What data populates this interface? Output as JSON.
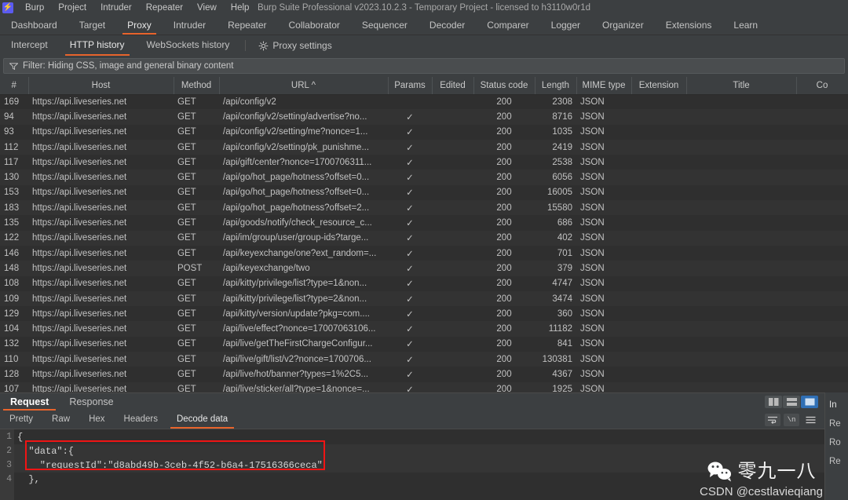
{
  "window": {
    "title": "Burp Suite Professional v2023.10.2.3 - Temporary Project - licensed to h3110w0r1d",
    "logo_icon": "burp-lightning-icon"
  },
  "menubar": {
    "items": [
      "Burp",
      "Project",
      "Intruder",
      "Repeater",
      "View",
      "Help"
    ]
  },
  "main_tabs": {
    "active": "Proxy",
    "items": [
      "Dashboard",
      "Target",
      "Proxy",
      "Intruder",
      "Repeater",
      "Collaborator",
      "Sequencer",
      "Decoder",
      "Comparer",
      "Logger",
      "Organizer",
      "Extensions",
      "Learn"
    ]
  },
  "sub_tabs": {
    "active": "HTTP history",
    "items": [
      "Intercept",
      "HTTP history",
      "WebSockets history"
    ],
    "settings_label": "Proxy settings",
    "settings_icon": "gear-icon"
  },
  "filter": {
    "icon": "funnel-icon",
    "text": "Filter: Hiding CSS, image and general binary content"
  },
  "table": {
    "columns": [
      "#",
      "Host",
      "Method",
      "URL ^",
      "Params",
      "Edited",
      "Status code",
      "Length",
      "MIME type",
      "Extension",
      "Title",
      "Co"
    ],
    "check_glyph": "✓",
    "rows": [
      {
        "num": "169",
        "host": "https://api.liveseries.net",
        "method": "GET",
        "url": "/api/config/v2",
        "params": "",
        "edited": "",
        "status": "200",
        "length": "2308",
        "mime": "JSON",
        "extension": "",
        "title": ""
      },
      {
        "num": "94",
        "host": "https://api.liveseries.net",
        "method": "GET",
        "url": "/api/config/v2/setting/advertise?no...",
        "params": "✓",
        "edited": "",
        "status": "200",
        "length": "8716",
        "mime": "JSON",
        "extension": "",
        "title": ""
      },
      {
        "num": "93",
        "host": "https://api.liveseries.net",
        "method": "GET",
        "url": "/api/config/v2/setting/me?nonce=1...",
        "params": "✓",
        "edited": "",
        "status": "200",
        "length": "1035",
        "mime": "JSON",
        "extension": "",
        "title": ""
      },
      {
        "num": "112",
        "host": "https://api.liveseries.net",
        "method": "GET",
        "url": "/api/config/v2/setting/pk_punishme...",
        "params": "✓",
        "edited": "",
        "status": "200",
        "length": "2419",
        "mime": "JSON",
        "extension": "",
        "title": ""
      },
      {
        "num": "117",
        "host": "https://api.liveseries.net",
        "method": "GET",
        "url": "/api/gift/center?nonce=1700706311...",
        "params": "✓",
        "edited": "",
        "status": "200",
        "length": "2538",
        "mime": "JSON",
        "extension": "",
        "title": ""
      },
      {
        "num": "130",
        "host": "https://api.liveseries.net",
        "method": "GET",
        "url": "/api/go/hot_page/hotness?offset=0...",
        "params": "✓",
        "edited": "",
        "status": "200",
        "length": "6056",
        "mime": "JSON",
        "extension": "",
        "title": ""
      },
      {
        "num": "153",
        "host": "https://api.liveseries.net",
        "method": "GET",
        "url": "/api/go/hot_page/hotness?offset=0...",
        "params": "✓",
        "edited": "",
        "status": "200",
        "length": "16005",
        "mime": "JSON",
        "extension": "",
        "title": ""
      },
      {
        "num": "183",
        "host": "https://api.liveseries.net",
        "method": "GET",
        "url": "/api/go/hot_page/hotness?offset=2...",
        "params": "✓",
        "edited": "",
        "status": "200",
        "length": "15580",
        "mime": "JSON",
        "extension": "",
        "title": ""
      },
      {
        "num": "135",
        "host": "https://api.liveseries.net",
        "method": "GET",
        "url": "/api/goods/notify/check_resource_c...",
        "params": "✓",
        "edited": "",
        "status": "200",
        "length": "686",
        "mime": "JSON",
        "extension": "",
        "title": ""
      },
      {
        "num": "122",
        "host": "https://api.liveseries.net",
        "method": "GET",
        "url": "/api/im/group/user/group-ids?targe...",
        "params": "✓",
        "edited": "",
        "status": "200",
        "length": "402",
        "mime": "JSON",
        "extension": "",
        "title": ""
      },
      {
        "num": "146",
        "host": "https://api.liveseries.net",
        "method": "GET",
        "url": "/api/keyexchange/one?ext_random=...",
        "params": "✓",
        "edited": "",
        "status": "200",
        "length": "701",
        "mime": "JSON",
        "extension": "",
        "title": ""
      },
      {
        "num": "148",
        "host": "https://api.liveseries.net",
        "method": "POST",
        "url": "/api/keyexchange/two",
        "params": "✓",
        "edited": "",
        "status": "200",
        "length": "379",
        "mime": "JSON",
        "extension": "",
        "title": ""
      },
      {
        "num": "108",
        "host": "https://api.liveseries.net",
        "method": "GET",
        "url": "/api/kitty/privilege/list?type=1&non...",
        "params": "✓",
        "edited": "",
        "status": "200",
        "length": "4747",
        "mime": "JSON",
        "extension": "",
        "title": ""
      },
      {
        "num": "109",
        "host": "https://api.liveseries.net",
        "method": "GET",
        "url": "/api/kitty/privilege/list?type=2&non...",
        "params": "✓",
        "edited": "",
        "status": "200",
        "length": "3474",
        "mime": "JSON",
        "extension": "",
        "title": ""
      },
      {
        "num": "129",
        "host": "https://api.liveseries.net",
        "method": "GET",
        "url": "/api/kitty/version/update?pkg=com....",
        "params": "✓",
        "edited": "",
        "status": "200",
        "length": "360",
        "mime": "JSON",
        "extension": "",
        "title": ""
      },
      {
        "num": "104",
        "host": "https://api.liveseries.net",
        "method": "GET",
        "url": "/api/live/effect?nonce=17007063106...",
        "params": "✓",
        "edited": "",
        "status": "200",
        "length": "11182",
        "mime": "JSON",
        "extension": "",
        "title": ""
      },
      {
        "num": "132",
        "host": "https://api.liveseries.net",
        "method": "GET",
        "url": "/api/live/getTheFirstChargeConfigur...",
        "params": "✓",
        "edited": "",
        "status": "200",
        "length": "841",
        "mime": "JSON",
        "extension": "",
        "title": ""
      },
      {
        "num": "110",
        "host": "https://api.liveseries.net",
        "method": "GET",
        "url": "/api/live/gift/list/v2?nonce=1700706...",
        "params": "✓",
        "edited": "",
        "status": "200",
        "length": "130381",
        "mime": "JSON",
        "extension": "",
        "title": ""
      },
      {
        "num": "128",
        "host": "https://api.liveseries.net",
        "method": "GET",
        "url": "/api/live/hot/banner?types=1%2C5...",
        "params": "✓",
        "edited": "",
        "status": "200",
        "length": "4367",
        "mime": "JSON",
        "extension": "",
        "title": ""
      },
      {
        "num": "107",
        "host": "https://api.liveseries.net",
        "method": "GET",
        "url": "/api/live/sticker/all?type=1&nonce=...",
        "params": "✓",
        "edited": "",
        "status": "200",
        "length": "1925",
        "mime": "JSON",
        "extension": "",
        "title": ""
      }
    ]
  },
  "detail_panel": {
    "tabs": [
      "Request",
      "Response"
    ],
    "active_tab": "Request",
    "view_tabs": [
      "Pretty",
      "Raw",
      "Hex",
      "Headers",
      "Decode data"
    ],
    "active_view": "Decode data",
    "layout_buttons": [
      {
        "name": "side-by-side-layout-icon",
        "selected": false
      },
      {
        "name": "stacked-layout-icon",
        "selected": false
      },
      {
        "name": "single-pane-layout-icon",
        "selected": true
      }
    ],
    "view_buttons": [
      {
        "name": "word-wrap-icon",
        "label": ""
      },
      {
        "name": "show-newlines-icon",
        "label": "\\n"
      },
      {
        "name": "more-options-icon",
        "label": ""
      }
    ],
    "code_lines": [
      {
        "n": "1",
        "text": "{"
      },
      {
        "n": "2",
        "text": "  \"data\":{"
      },
      {
        "n": "3",
        "text": "    \"requestId\":\"d8abd49b-3ceb-4f52-b6a4-17516366ceca\""
      },
      {
        "n": "4",
        "text": "  },"
      }
    ],
    "highlight_color": "#f01414"
  },
  "right_rail": {
    "items": [
      "In",
      "Re",
      "Ro",
      "Re"
    ]
  },
  "watermark": {
    "icon": "wechat-icon",
    "chinese": "零九一八",
    "credit": "CSDN @cestlavieqiang"
  },
  "colors": {
    "accent": "#e8642c",
    "selected_blue": "#2f6fb5",
    "panel_bg": "#3c3f41",
    "table_bg": "#2f2f2f"
  }
}
